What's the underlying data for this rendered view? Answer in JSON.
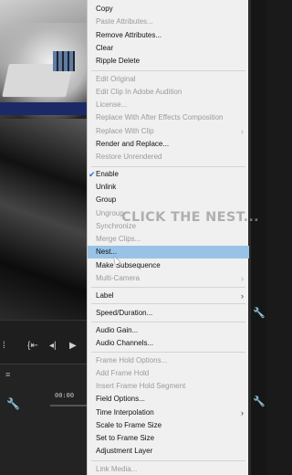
{
  "menu": {
    "items": [
      {
        "label": "Copy",
        "enabled": true
      },
      {
        "label": "Paste Attributes...",
        "enabled": false
      },
      {
        "label": "Remove Attributes...",
        "enabled": true
      },
      {
        "label": "Clear",
        "enabled": true
      },
      {
        "label": "Ripple Delete",
        "enabled": true
      },
      {
        "label": "Edit Original",
        "enabled": false
      },
      {
        "label": "Edit Clip In Adobe Audition",
        "enabled": false
      },
      {
        "label": "License...",
        "enabled": false
      },
      {
        "label": "Replace With After Effects Composition",
        "enabled": false
      },
      {
        "label": "Replace With Clip",
        "enabled": false
      },
      {
        "label": "Render and Replace...",
        "enabled": true
      },
      {
        "label": "Restore Unrendered",
        "enabled": false
      },
      {
        "label": "Enable",
        "enabled": true,
        "checked": true
      },
      {
        "label": "Unlink",
        "enabled": true
      },
      {
        "label": "Group",
        "enabled": true
      },
      {
        "label": "Ungroup",
        "enabled": false
      },
      {
        "label": "Synchronize",
        "enabled": false
      },
      {
        "label": "Merge Clips...",
        "enabled": false
      },
      {
        "label": "Nest...",
        "enabled": true,
        "highlighted": true
      },
      {
        "label": "Make Subsequence",
        "enabled": true
      },
      {
        "label": "Multi-Camera",
        "enabled": false
      },
      {
        "label": "Label",
        "enabled": true
      },
      {
        "label": "Speed/Duration...",
        "enabled": true
      },
      {
        "label": "Audio Gain...",
        "enabled": true
      },
      {
        "label": "Audio Channels...",
        "enabled": true
      },
      {
        "label": "Frame Hold Options...",
        "enabled": false
      },
      {
        "label": "Add Frame Hold",
        "enabled": false
      },
      {
        "label": "Insert Frame Hold Segment",
        "enabled": false
      },
      {
        "label": "Field Options...",
        "enabled": true
      },
      {
        "label": "Time Interpolation",
        "enabled": true
      },
      {
        "label": "Scale to Frame Size",
        "enabled": true
      },
      {
        "label": "Set to Frame Size",
        "enabled": true
      },
      {
        "label": "Adjustment Layer",
        "enabled": true
      },
      {
        "label": "Link Media...",
        "enabled": false
      }
    ]
  },
  "overlay": {
    "caption": "CLICK THE NEST..."
  },
  "timeline": {
    "timecode": "00:00",
    "menu_glyph": "≡"
  },
  "icons": {
    "check": "checkmark-icon",
    "submenu": "chevron-right-icon",
    "wrench": "wrench-icon",
    "cursor": "mouse-pointer-icon"
  },
  "colors": {
    "menu_bg": "#f0f0f0",
    "highlight": "#99c3e6",
    "disabled_text": "#9a9a9a",
    "check": "#2a6fd1"
  }
}
